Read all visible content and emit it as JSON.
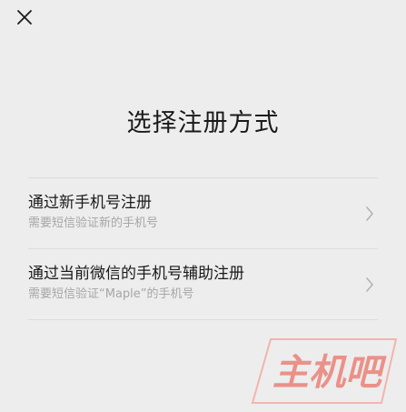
{
  "header": {
    "close_icon": "close-icon"
  },
  "title": "选择注册方式",
  "options": [
    {
      "title": "通过新手机号注册",
      "subtitle": "需要短信验证新的手机号",
      "icon": "chevron-right-icon"
    },
    {
      "title": "通过当前微信的手机号辅助注册",
      "subtitle": "需要短信验证“Maple”的手机号",
      "icon": "chevron-right-icon"
    }
  ],
  "watermark": {
    "text": "主机吧",
    "color": "#e86a5c"
  },
  "colors": {
    "background": "#ededed",
    "title_text": "#1a1a1a",
    "subtitle_text": "#a6a6a6",
    "divider": "#dcdcdc",
    "chevron": "#b2b2b2"
  }
}
